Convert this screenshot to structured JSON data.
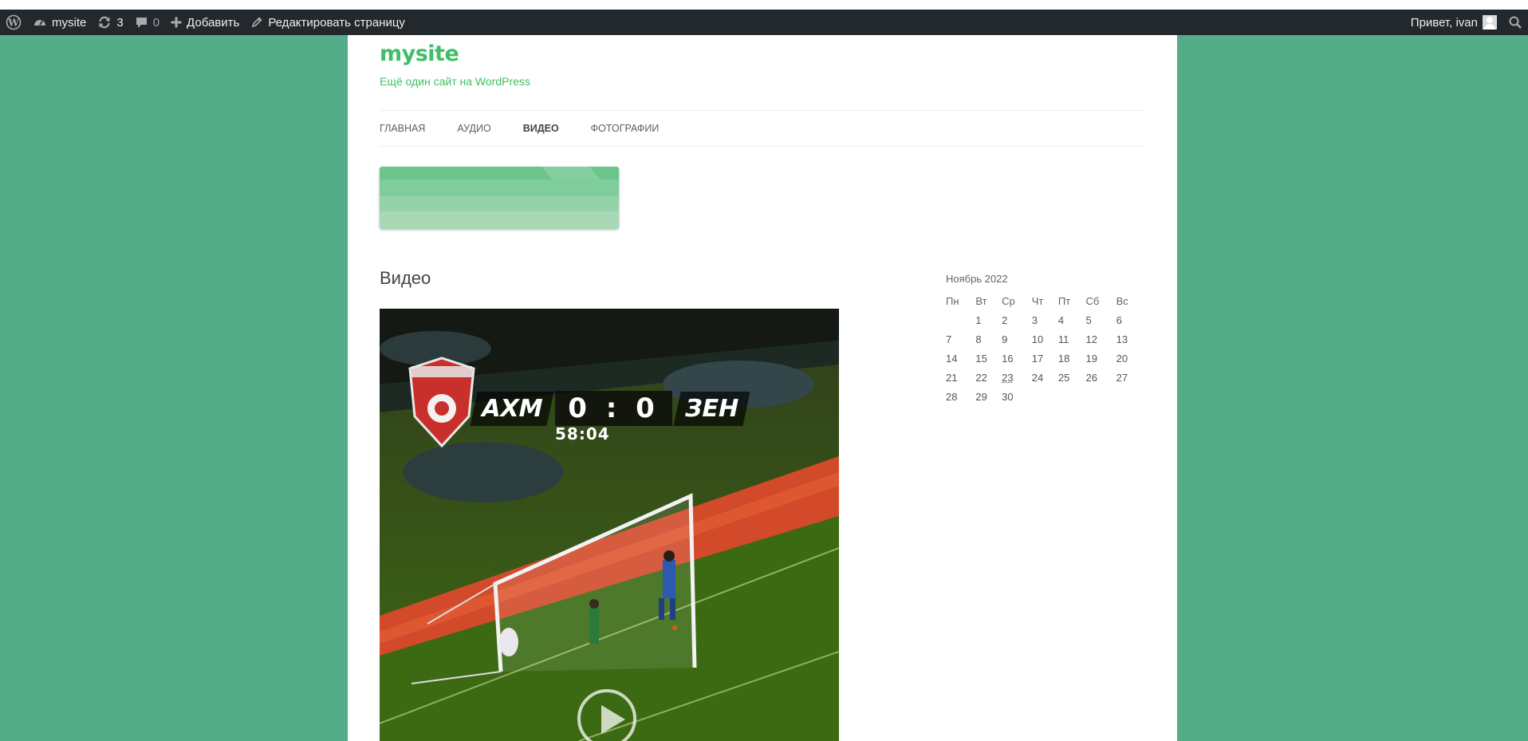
{
  "admin_bar": {
    "site_name": "mysite",
    "updates_count": "3",
    "comments_count": "0",
    "add_new": "Добавить",
    "edit_page": "Редактировать страницу",
    "greeting": "Привет, ivan"
  },
  "site": {
    "title": "mysite",
    "description": "Ещё один сайт на WordPress"
  },
  "nav": {
    "items": [
      "ГЛАВНАЯ",
      "АУДИО",
      "ВИДЕО",
      "ФОТОГРАФИИ"
    ],
    "current": "ВИДЕО"
  },
  "content": {
    "title": "Видео",
    "video": {
      "home_team": "АХМ",
      "score": "0 : 0",
      "away_team": "ЗЕН",
      "match_time": "58:04"
    }
  },
  "calendar": {
    "caption": "Ноябрь 2022",
    "weekdays": [
      "Пн",
      "Вт",
      "Ср",
      "Чт",
      "Пт",
      "Сб",
      "Вс"
    ],
    "weeks": [
      [
        "",
        "1",
        "2",
        "3",
        "4",
        "5",
        "6"
      ],
      [
        "7",
        "8",
        "9",
        "10",
        "11",
        "12",
        "13"
      ],
      [
        "14",
        "15",
        "16",
        "17",
        "18",
        "19",
        "20"
      ],
      [
        "21",
        "22",
        "23",
        "24",
        "25",
        "26",
        "27"
      ],
      [
        "28",
        "29",
        "30",
        "",
        "",
        "",
        ""
      ]
    ],
    "today": "23"
  },
  "colors": {
    "background": "#52ad88",
    "accent": "#3fbf65",
    "admin_bar": "#23282d"
  }
}
